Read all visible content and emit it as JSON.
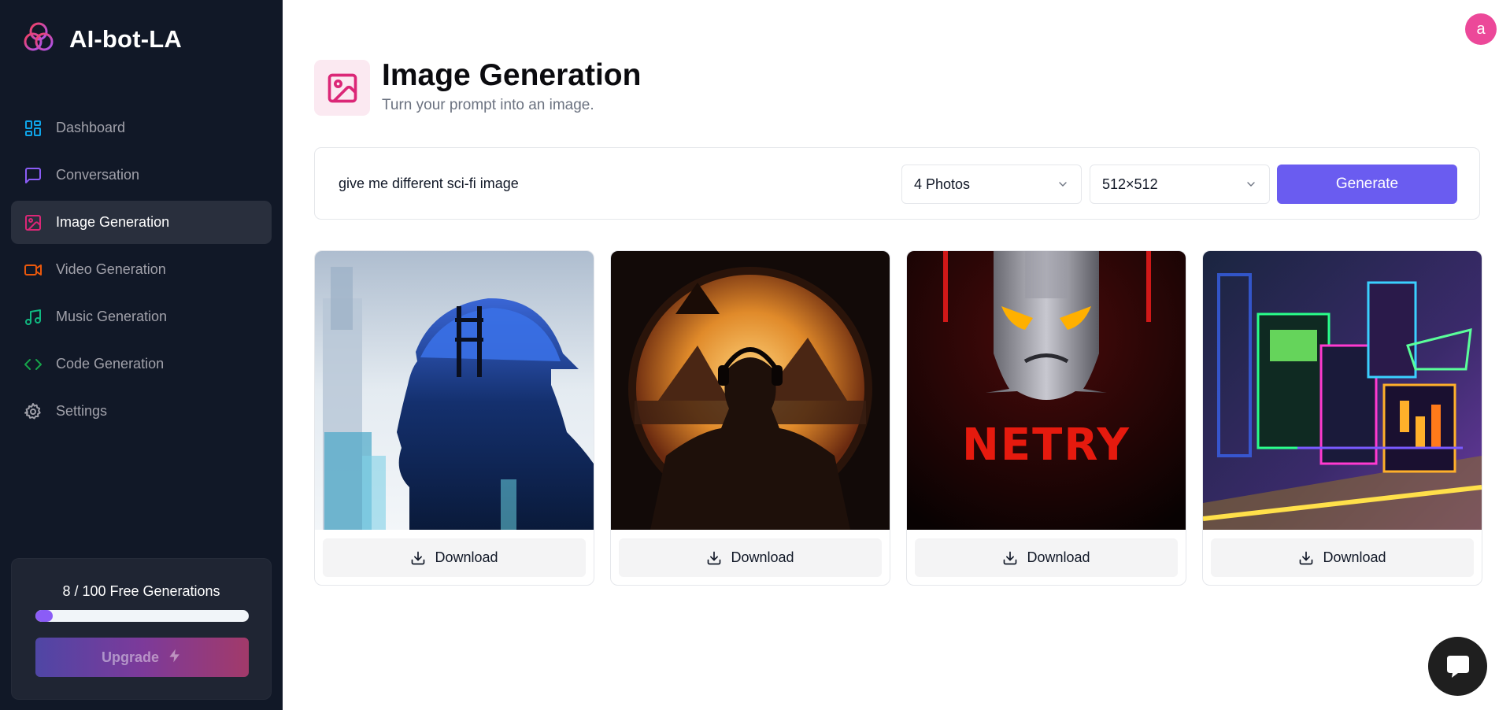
{
  "brand": {
    "name": "AI-bot-LA"
  },
  "sidebar": {
    "items": [
      {
        "label": "Dashboard",
        "icon": "dashboard-icon",
        "color": "#0ea5e9"
      },
      {
        "label": "Conversation",
        "icon": "message-square-icon",
        "color": "#8b5cf6"
      },
      {
        "label": "Image Generation",
        "icon": "image-icon",
        "color": "#db2777",
        "active": true
      },
      {
        "label": "Video Generation",
        "icon": "video-icon",
        "color": "#ea580c"
      },
      {
        "label": "Music Generation",
        "icon": "music-icon",
        "color": "#10b981"
      },
      {
        "label": "Code Generation",
        "icon": "code-icon",
        "color": "#16a34a"
      },
      {
        "label": "Settings",
        "icon": "gear-icon",
        "color": "#a1a1aa"
      }
    ]
  },
  "usage": {
    "text": "8 / 100 Free Generations",
    "used": 8,
    "limit": 100,
    "progress_fraction": 0.08,
    "upgrade_label": "Upgrade"
  },
  "user": {
    "avatar_letter": "a",
    "avatar_color": "#ec4899"
  },
  "heading": {
    "title": "Image Generation",
    "subtitle": "Turn your prompt into an image.",
    "icon": "image-icon",
    "color": "#db2777"
  },
  "form": {
    "prompt_value": "give me different sci-fi image",
    "count_selected": "4 Photos",
    "resolution_selected": "512×512",
    "generate_label": "Generate",
    "accent": "#6a5cf0"
  },
  "results": {
    "download_label": "Download",
    "images": [
      {
        "description": "construction worker silhouette double exposure"
      },
      {
        "description": "silhouette with headphones sunset mountains"
      },
      {
        "description": "robot head poster",
        "caption": "NETRY"
      },
      {
        "description": "neon cyberpunk structure"
      }
    ]
  }
}
